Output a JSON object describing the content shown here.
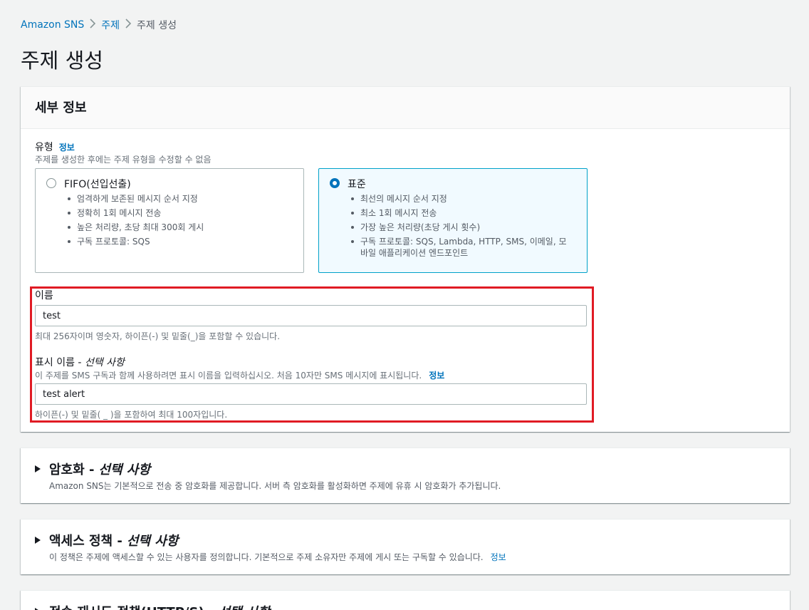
{
  "breadcrumb": {
    "items": [
      "Amazon SNS",
      "주제",
      "주제 생성"
    ]
  },
  "page": {
    "title": "주제 생성"
  },
  "details": {
    "header": "세부 정보",
    "type_label": "유형",
    "type_info": "정보",
    "type_desc": "주제를 생성한 후에는 주제 유형을 수정할 수 없음",
    "fifo": {
      "title": "FIFO(선입선출)",
      "selected": false,
      "bullets": [
        "엄격하게 보존된 메시지 순서 지정",
        "정확히 1회 메시지 전송",
        "높은 처리량, 초당 최대 300회 게시",
        "구독 프로토콜: SQS"
      ]
    },
    "standard": {
      "title": "표준",
      "selected": true,
      "bullets": [
        "최선의 메시지 순서 지정",
        "최소 1회 메시지 전송",
        "가장 높은 처리량(초당 게시 횟수)",
        "구독 프로토콜: SQS, Lambda, HTTP, SMS, 이메일, 모바일 애플리케이션 엔드포인트"
      ]
    },
    "name_label": "이름",
    "name_value": "test",
    "name_hint": "최대 256자이며 영숫자, 하이픈(-) 및 밑줄(_)을 포함할 수 있습니다.",
    "display_label": "표시 이름 - ",
    "display_label_optional": "선택 사항",
    "display_desc": "이 주제를 SMS 구독과 함께 사용하려면 표시 이름을 입력하십시오. 처음 10자만 SMS 메시지에 표시됩니다.",
    "display_info": "정보",
    "display_value": "test alert",
    "display_hint": "하이픈(-) 및 밑줄( _ )을 포함하여 최대 100자입니다."
  },
  "encryption": {
    "title": "암호화 - ",
    "optional": "선택 사항",
    "desc": "Amazon SNS는 기본적으로 전송 중 암호화를 제공합니다. 서버 측 암호화를 활성화하면 주제에 유휴 시 암호화가 추가됩니다."
  },
  "access_policy": {
    "title": "액세스 정책 - ",
    "optional": "선택 사항",
    "desc": "이 정책은 주제에 액세스할 수 있는 사용자를 정의합니다. 기본적으로 주제 소유자만 주제에 게시 또는 구독할 수 있습니다.",
    "info": "정보"
  },
  "delivery_retry": {
    "title": "전송 재시도 정책(HTTP/S) - ",
    "optional": "선택 사항"
  },
  "colors": {
    "link": "#0073bb",
    "highlight_border": "#e01b24",
    "selected_tile_bg": "#f1faff"
  }
}
